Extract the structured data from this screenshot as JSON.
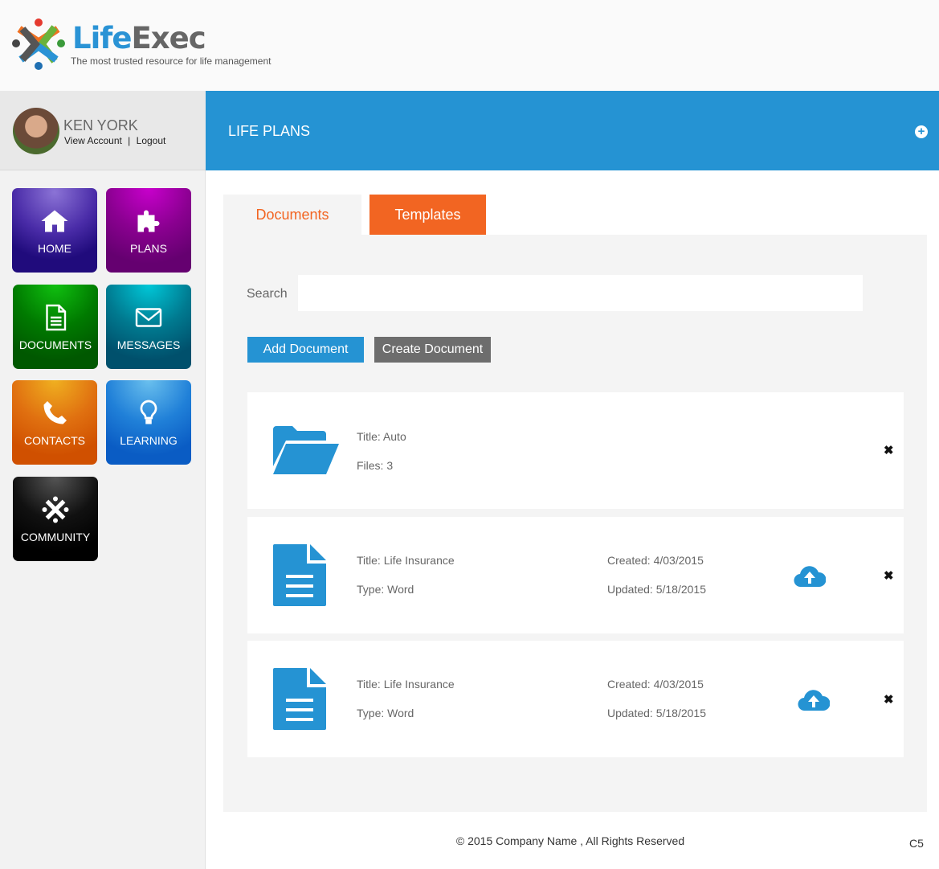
{
  "brand": {
    "name_a": "Life",
    "name_b": "Exec",
    "tagline": "The most trusted resource for life management"
  },
  "user": {
    "name": "KEN YORK",
    "view_account": "View Account",
    "sep": "|",
    "logout": "Logout"
  },
  "nav": [
    {
      "label": "HOME",
      "icon": "home-icon"
    },
    {
      "label": "PLANS",
      "icon": "puzzle-icon"
    },
    {
      "label": "DOCUMENTS",
      "icon": "document-icon"
    },
    {
      "label": "MESSAGES",
      "icon": "envelope-icon"
    },
    {
      "label": "CONTACTS",
      "icon": "phone-icon"
    },
    {
      "label": "LEARNING",
      "icon": "lightbulb-icon"
    },
    {
      "label": "COMMUNITY",
      "icon": "community-icon"
    }
  ],
  "header": {
    "title": "LIFE PLANS",
    "add": "+"
  },
  "tabs": {
    "documents": "Documents",
    "templates": "Templates"
  },
  "search": {
    "label": "Search",
    "placeholder": ""
  },
  "buttons": {
    "add": "Add Document",
    "create": "Create Document"
  },
  "items": [
    {
      "title": "Title: Auto",
      "files": "Files: 3"
    },
    {
      "title": "Title: Life Insurance",
      "type": "Type: Word",
      "created": "Created: 4/03/2015",
      "updated": "Updated: 5/18/2015"
    },
    {
      "title": "Title: Life Insurance",
      "type": "Type: Word",
      "created": "Created: 4/03/2015",
      "updated": "Updated: 5/18/2015"
    }
  ],
  "close_glyph": "✖",
  "footer": {
    "copyright": "© 2015 Company Name , All Rights Reserved",
    "code": "C5"
  },
  "colors": {
    "accent": "#2593d3",
    "orange": "#f26522",
    "gray_button": "#6d6d6d"
  }
}
